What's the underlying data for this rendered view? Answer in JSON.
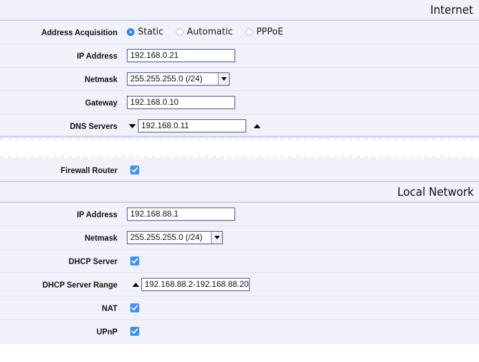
{
  "sections": {
    "internet": {
      "title": "Internet",
      "rows": {
        "address_acquisition": {
          "label": "Address Acquisition",
          "options": [
            {
              "label": "Static",
              "selected": true
            },
            {
              "label": "Automatic",
              "selected": false
            },
            {
              "label": "PPPoE",
              "selected": false
            }
          ]
        },
        "ip_address": {
          "label": "IP Address",
          "value": "192.168.0.21"
        },
        "netmask": {
          "label": "Netmask",
          "value": "255.255.255.0 (/24)"
        },
        "gateway": {
          "label": "Gateway",
          "value": "192.168.0.10"
        },
        "dns_servers": {
          "label": "DNS Servers",
          "value": "192.168.0.11",
          "left_icon": "triangle-down-icon",
          "right_icon": "triangle-up-icon"
        }
      }
    },
    "firewall": {
      "rows": {
        "firewall_router": {
          "label": "Firewall Router",
          "checked": true
        }
      }
    },
    "local_network": {
      "title": "Local Network",
      "rows": {
        "ip_address": {
          "label": "IP Address",
          "value": "192.168.88.1"
        },
        "netmask": {
          "label": "Netmask",
          "value": "255.255.255.0 (/24)"
        },
        "dhcp_server": {
          "label": "DHCP Server",
          "checked": true
        },
        "dhcp_server_range": {
          "label": "DHCP Server Range",
          "value": "192.168.88.2-192.168.88.20",
          "left_icon": "triangle-up-icon"
        },
        "nat": {
          "label": "NAT",
          "checked": true
        },
        "upnp": {
          "label": "UPnP",
          "checked": true
        }
      }
    }
  },
  "colors": {
    "panel_bg": "#f1f1fa",
    "page_bg": "#ffffff",
    "accent_blue": "#3b93f7",
    "radio_blue": "#2d8cf5",
    "input_border": "#505a86",
    "rule_light": "#dfe2f1",
    "rule_dark": "#b9bfdd",
    "text": "#111111"
  }
}
